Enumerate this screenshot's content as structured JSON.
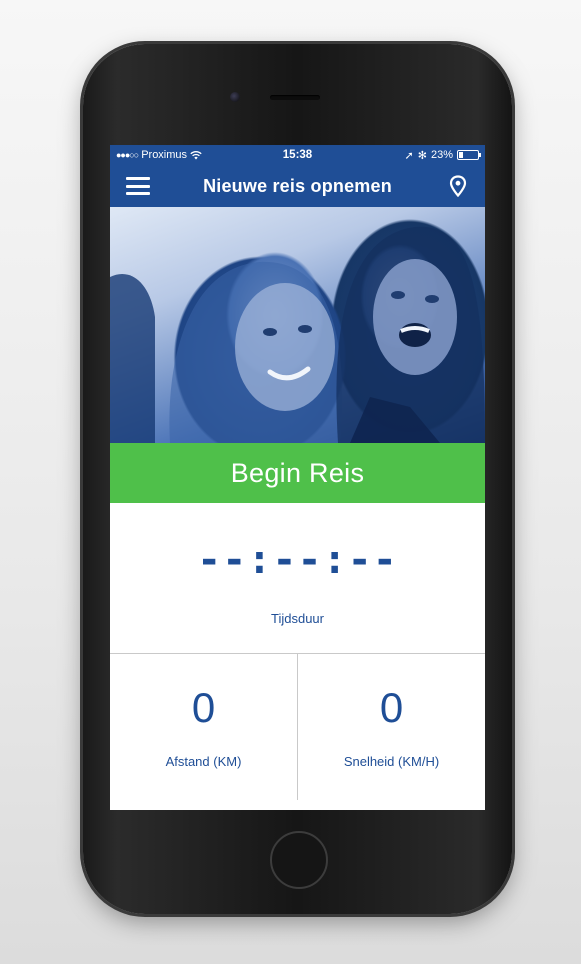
{
  "status_bar": {
    "signal": "●●●○○",
    "carrier": "Proximus",
    "wifi": "wifi-icon",
    "time": "15:38",
    "location_arrow": "➚",
    "bluetooth": "✻",
    "battery_percent": "23%",
    "battery_level": 0.23
  },
  "navbar": {
    "title": "Nieuwe reis opnemen",
    "menu_icon": "hamburger-menu-icon",
    "location_icon": "map-pin-icon"
  },
  "main": {
    "begin_button": "Begin Reis",
    "timer": "--:--:--",
    "timer_label": "Tijdsduur",
    "stats": [
      {
        "value": "0",
        "label": "Afstand (KM)"
      },
      {
        "value": "0",
        "label": "Snelheid (KM/H)"
      }
    ]
  },
  "colors": {
    "primary": "#1f4e96",
    "accent_green": "#4fc04a",
    "divider": "#c9c9c9"
  }
}
